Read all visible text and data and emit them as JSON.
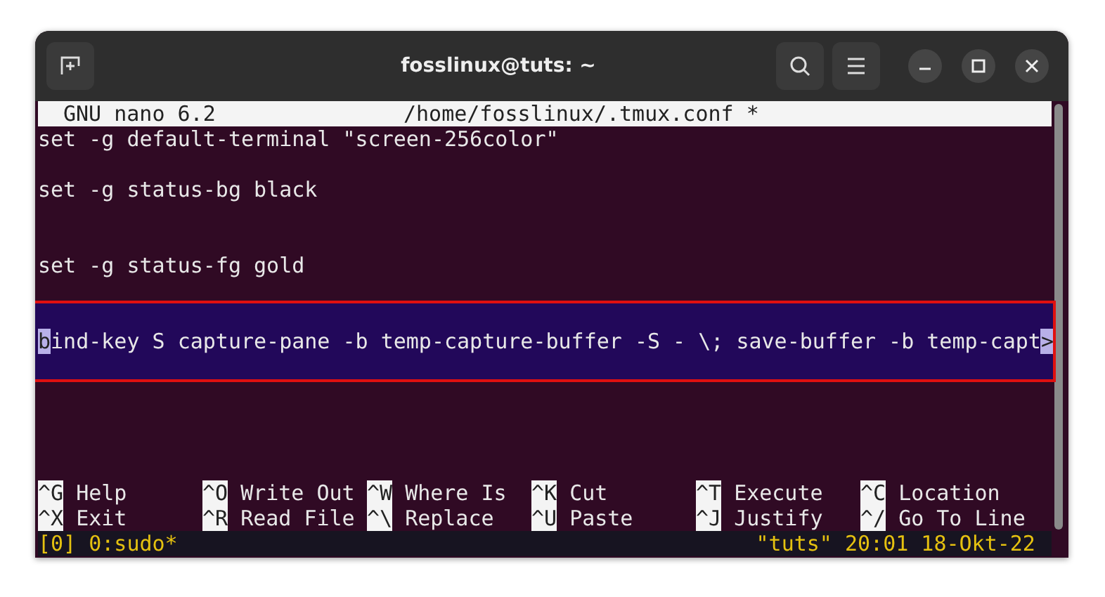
{
  "window": {
    "title": "fosslinux@tuts: ~"
  },
  "nano_header": {
    "version": "GNU nano 6.2",
    "file": "/home/fosslinux/.tmux.conf *"
  },
  "lines": [
    {
      "kind": "text",
      "text": "set -g default-terminal \"screen-256color\"",
      "highlighted": false
    },
    {
      "kind": "blank",
      "highlighted": false
    },
    {
      "kind": "text",
      "text": "set -g status-bg black",
      "highlighted": false
    },
    {
      "kind": "blank",
      "highlighted": false
    },
    {
      "kind": "blank",
      "highlighted": false
    },
    {
      "kind": "text",
      "text": "set -g status-fg gold",
      "highlighted": false
    },
    {
      "kind": "blank",
      "highlighted": false
    },
    {
      "kind": "blank",
      "highlighted": true
    },
    {
      "kind": "cursor",
      "cursor_char": "b",
      "text": "ind-key S capture-pane -b temp-capture-buffer -S - \\; save-buffer -b temp-capt",
      "overflow_mark": ">",
      "highlighted": true
    },
    {
      "kind": "blank",
      "highlighted": true
    },
    {
      "kind": "blank",
      "highlighted": false
    },
    {
      "kind": "blank",
      "highlighted": false
    },
    {
      "kind": "blank",
      "highlighted": false
    },
    {
      "kind": "blank",
      "highlighted": false
    }
  ],
  "shortcuts": [
    [
      {
        "key": "^G",
        "label": "Help"
      },
      {
        "key": "^O",
        "label": "Write Out"
      },
      {
        "key": "^W",
        "label": "Where Is"
      },
      {
        "key": "^K",
        "label": "Cut"
      },
      {
        "key": "^T",
        "label": "Execute"
      },
      {
        "key": "^C",
        "label": "Location"
      }
    ],
    [
      {
        "key": "^X",
        "label": "Exit"
      },
      {
        "key": "^R",
        "label": "Read File"
      },
      {
        "key": "^\\",
        "label": "Replace"
      },
      {
        "key": "^U",
        "label": "Paste"
      },
      {
        "key": "^J",
        "label": "Justify"
      },
      {
        "key": "^/",
        "label": "Go To Line"
      }
    ]
  ],
  "tmux_status": {
    "left": "[0] 0:sudo*",
    "right": "\"tuts\" 20:01 18-Okt-22"
  }
}
